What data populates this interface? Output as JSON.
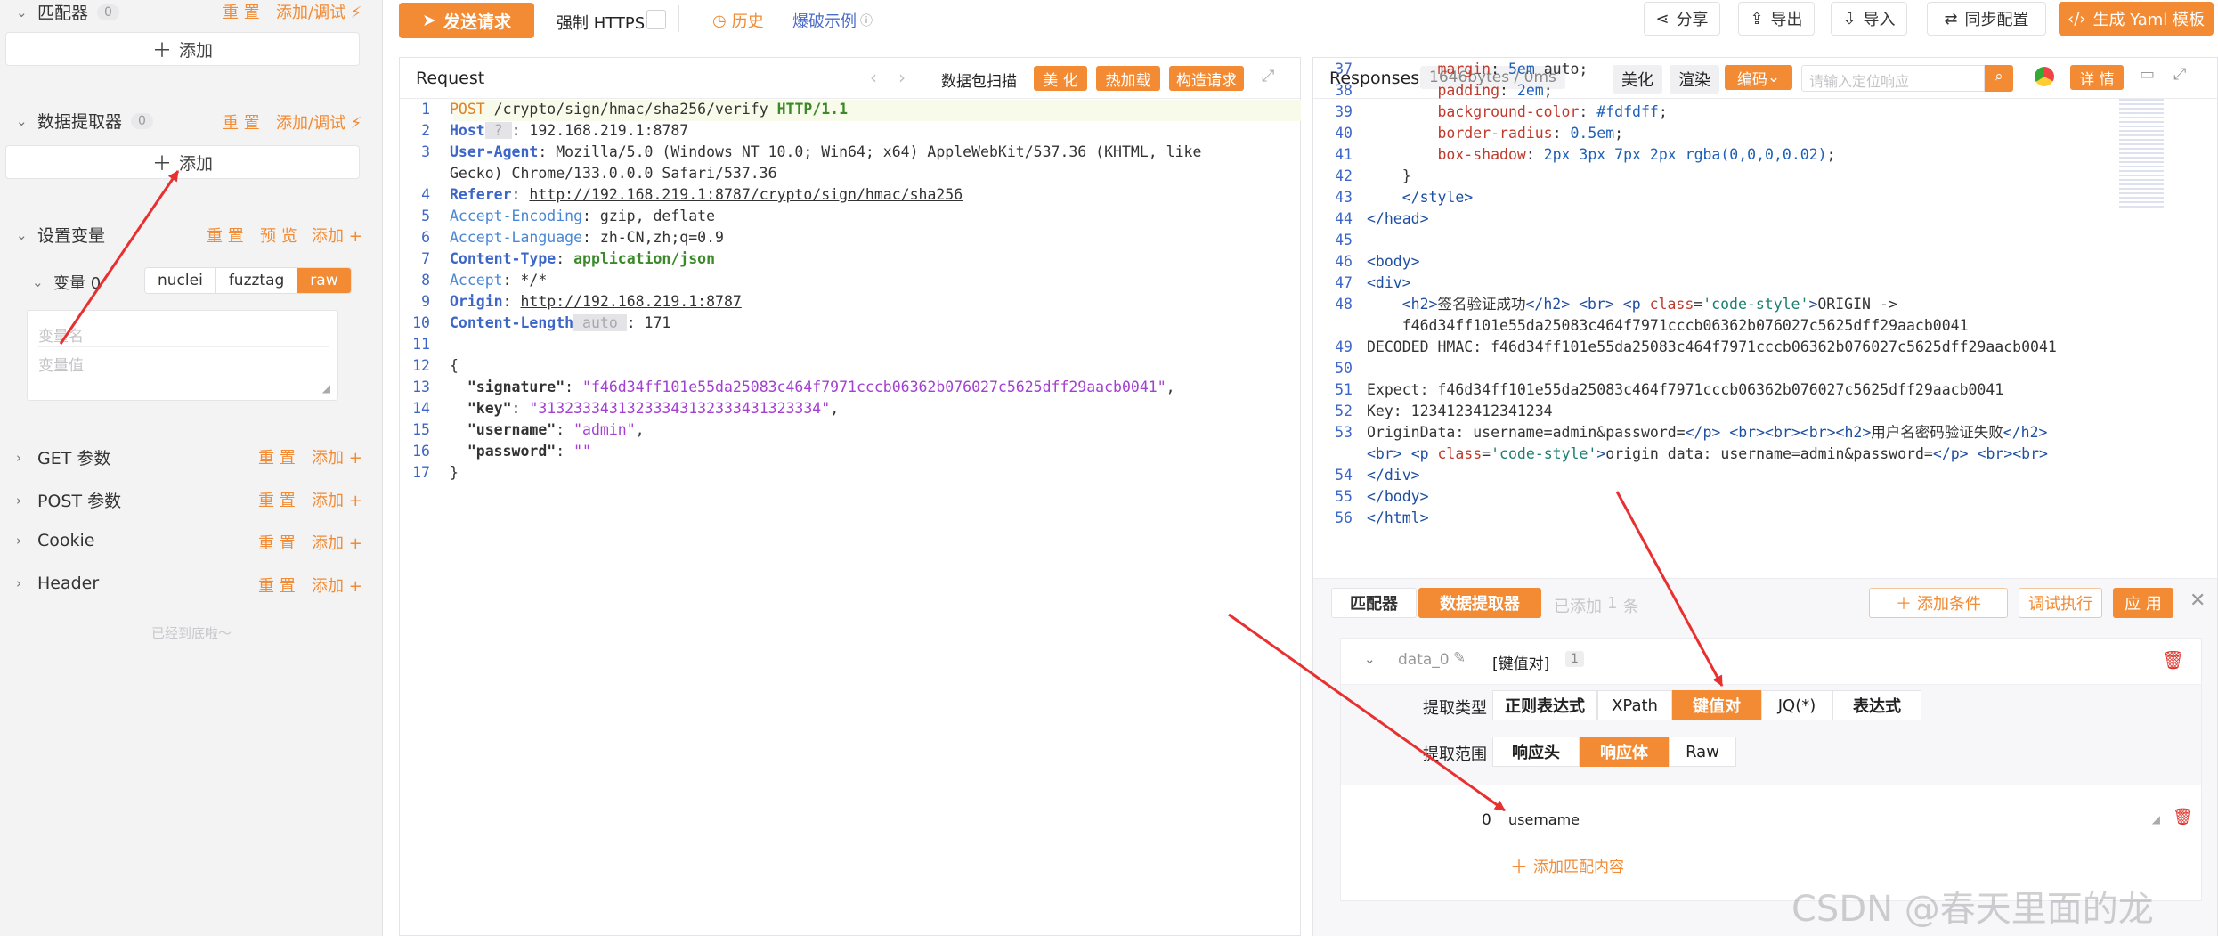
{
  "left": {
    "matcher": {
      "title": "匹配器",
      "count": "0",
      "reset": "重 置",
      "add_debug": "添加/调试 ⚡",
      "add": "添加"
    },
    "extractor": {
      "title": "数据提取器",
      "count": "0",
      "reset": "重 置",
      "add_debug": "添加/调试 ⚡",
      "add": "添加"
    },
    "set_vars": {
      "title": "设置变量",
      "reset": "重 置",
      "preview": "预 览",
      "add": "添加 +"
    },
    "variable": {
      "label": "变量 0",
      "modes": [
        "nuclei",
        "fuzztag",
        "raw"
      ],
      "active_mode": "raw",
      "name_placeholder": "变量名",
      "value_placeholder": "变量值"
    },
    "sections": [
      {
        "title": "GET 参数",
        "reset": "重 置",
        "add": "添加 +"
      },
      {
        "title": "POST 参数",
        "reset": "重 置",
        "add": "添加 +"
      },
      {
        "title": "Cookie",
        "reset": "重 置",
        "add": "添加 +"
      },
      {
        "title": "Header",
        "reset": "重 置",
        "add": "添加 +"
      }
    ],
    "end_text": "已经到底啦～"
  },
  "toolbar": {
    "send": "发送请求",
    "force_https": "强制 HTTPS",
    "history": "历史",
    "example": "爆破示例",
    "share": "分享",
    "export": "导出",
    "import": "导入",
    "sync": "同步配置",
    "gen_yaml": "生成 Yaml 模板"
  },
  "request": {
    "title": "Request",
    "scan": "数据包扫描",
    "beautify": "美 化",
    "hot_load": "热加载",
    "construct": "构造请求",
    "lines": [
      {
        "n": "1",
        "parts": [
          [
            "mth",
            "POST"
          ],
          [
            "val",
            " /crypto/sign/hmac/sha256/verify "
          ],
          [
            "grn",
            "HTTP/1.1"
          ]
        ]
      },
      {
        "n": "2",
        "parts": [
          [
            "k1",
            "Host"
          ],
          [
            "muted",
            " ? "
          ],
          [
            "val",
            ": 192.168.219.1:8787"
          ]
        ]
      },
      {
        "n": "3",
        "parts": [
          [
            "k1",
            "User-Agent"
          ],
          [
            "val",
            ": Mozilla/5.0 (Windows NT 10.0; Win64; x64) AppleWebKit/537.36 (KHTML, like"
          ]
        ]
      },
      {
        "n": "",
        "parts": [
          [
            "val",
            "Gecko) Chrome/133.0.0.0 Safari/537.36"
          ]
        ]
      },
      {
        "n": "4",
        "parts": [
          [
            "k1",
            "Referer"
          ],
          [
            "val",
            ": "
          ],
          [
            "valu",
            "http://192.168.219.1:8787/crypto/sign/hmac/sha256"
          ]
        ]
      },
      {
        "n": "5",
        "parts": [
          [
            "k2",
            "Accept-Encoding"
          ],
          [
            "val",
            ": gzip, deflate"
          ]
        ]
      },
      {
        "n": "6",
        "parts": [
          [
            "k2",
            "Accept-Language"
          ],
          [
            "val",
            ": zh-CN,zh;q=0.9"
          ]
        ]
      },
      {
        "n": "7",
        "parts": [
          [
            "k1",
            "Content-Type"
          ],
          [
            "val",
            ": "
          ],
          [
            "grn",
            "application/json"
          ]
        ]
      },
      {
        "n": "8",
        "parts": [
          [
            "k2",
            "Accept"
          ],
          [
            "val",
            ": */*"
          ]
        ]
      },
      {
        "n": "9",
        "parts": [
          [
            "k1",
            "Origin"
          ],
          [
            "val",
            ": "
          ],
          [
            "valu",
            "http://192.168.219.1:8787"
          ]
        ]
      },
      {
        "n": "10",
        "parts": [
          [
            "k1",
            "Content-Length"
          ],
          [
            "muted",
            " auto "
          ],
          [
            "val",
            ": 171"
          ]
        ]
      },
      {
        "n": "11",
        "parts": []
      },
      {
        "n": "12",
        "parts": [
          [
            "val",
            "{"
          ]
        ]
      },
      {
        "n": "13",
        "parts": [
          [
            "jk",
            "  \"signature\""
          ],
          [
            "val",
            ": "
          ],
          [
            "jv",
            "\"f46d34ff101e55da25083c464f7971cccb06362b076027c5625dff29aacb0041\""
          ],
          [
            "val",
            ","
          ]
        ]
      },
      {
        "n": "14",
        "parts": [
          [
            "jk",
            "  \"key\""
          ],
          [
            "val",
            ": "
          ],
          [
            "jv",
            "\"31323334313233343132333431323334\""
          ],
          [
            "val",
            ","
          ]
        ]
      },
      {
        "n": "15",
        "parts": [
          [
            "jk",
            "  \"username\""
          ],
          [
            "val",
            ": "
          ],
          [
            "jv",
            "\"admin\""
          ],
          [
            "val",
            ","
          ]
        ]
      },
      {
        "n": "16",
        "parts": [
          [
            "jk",
            "  \"password\""
          ],
          [
            "val",
            ": "
          ],
          [
            "jv",
            "\"\""
          ]
        ]
      },
      {
        "n": "17",
        "parts": [
          [
            "val",
            "}"
          ]
        ]
      }
    ]
  },
  "responses": {
    "title": "Responses",
    "size": "1646bytes / 0ms",
    "beautify": "美化",
    "render": "渲染",
    "encoding": "编码",
    "search_placeholder": "请输入定位响应",
    "detail": "详 情",
    "lines": [
      {
        "n": "37",
        "parts": [
          [
            "rattr",
            "        margin"
          ],
          [
            "val",
            ": "
          ],
          [
            "rn",
            "5em"
          ],
          [
            "val",
            " auto;"
          ]
        ]
      },
      {
        "n": "38",
        "parts": [
          [
            "rattr",
            "        padding"
          ],
          [
            "val",
            ": "
          ],
          [
            "rn",
            "2em"
          ],
          [
            "val",
            ";"
          ]
        ]
      },
      {
        "n": "39",
        "parts": [
          [
            "rattr",
            "        background-color"
          ],
          [
            "val",
            ": "
          ],
          [
            "rn",
            "#fdfdff"
          ],
          [
            "val",
            ";"
          ]
        ]
      },
      {
        "n": "40",
        "parts": [
          [
            "rattr",
            "        border-radius"
          ],
          [
            "val",
            ": "
          ],
          [
            "rn",
            "0.5em"
          ],
          [
            "val",
            ";"
          ]
        ]
      },
      {
        "n": "41",
        "parts": [
          [
            "rattr",
            "        box-shadow"
          ],
          [
            "val",
            ": "
          ],
          [
            "rn",
            "2px 3px 7px 2px rgba(0,0,0,0.02)"
          ],
          [
            "val",
            ";"
          ]
        ]
      },
      {
        "n": "42",
        "parts": [
          [
            "val",
            "    }"
          ]
        ]
      },
      {
        "n": "43",
        "parts": [
          [
            "val",
            "    "
          ],
          [
            "rtag",
            "</style>"
          ]
        ]
      },
      {
        "n": "44",
        "parts": [
          [
            "rtag",
            "</head>"
          ]
        ]
      },
      {
        "n": "45",
        "parts": []
      },
      {
        "n": "46",
        "parts": [
          [
            "rtag",
            "<body>"
          ]
        ]
      },
      {
        "n": "47",
        "parts": [
          [
            "rtag",
            "<div>"
          ]
        ]
      },
      {
        "n": "48",
        "parts": [
          [
            "val",
            "    "
          ],
          [
            "rtag",
            "<h2>"
          ],
          [
            "val",
            "签名验证成功"
          ],
          [
            "rtag",
            "</h2>"
          ],
          [
            "val",
            " "
          ],
          [
            "rtag",
            "<br>"
          ],
          [
            "val",
            " "
          ],
          [
            "rtag",
            "<p "
          ],
          [
            "rattr",
            "class"
          ],
          [
            "val",
            "="
          ],
          [
            "rsv",
            "'code-style'"
          ],
          [
            "rtag",
            ">"
          ],
          [
            "val",
            "ORIGIN -> "
          ]
        ]
      },
      {
        "n": "",
        "parts": [
          [
            "val",
            "    f46d34ff101e55da25083c464f7971cccb06362b076027c5625dff29aacb0041"
          ]
        ]
      },
      {
        "n": "49",
        "parts": [
          [
            "val",
            "DECODED HMAC: f46d34ff101e55da25083c464f7971cccb06362b076027c5625dff29aacb0041"
          ]
        ]
      },
      {
        "n": "50",
        "parts": []
      },
      {
        "n": "51",
        "parts": [
          [
            "val",
            "Expect: f46d34ff101e55da25083c464f7971cccb06362b076027c5625dff29aacb0041"
          ]
        ]
      },
      {
        "n": "52",
        "parts": [
          [
            "val",
            "Key: 1234123412341234"
          ]
        ]
      },
      {
        "n": "53",
        "parts": [
          [
            "val",
            "OriginData: username=admin&password="
          ],
          [
            "rtag",
            "</p>"
          ],
          [
            "val",
            " "
          ],
          [
            "rtag",
            "<br><br><br><h2>"
          ],
          [
            "val",
            "用户名密码验证失败"
          ],
          [
            "rtag",
            "</h2>"
          ]
        ]
      },
      {
        "n": "",
        "parts": [
          [
            "rtag",
            "<br>"
          ],
          [
            "val",
            " "
          ],
          [
            "rtag",
            "<p "
          ],
          [
            "rattr",
            "class"
          ],
          [
            "val",
            "="
          ],
          [
            "rsv",
            "'code-style'"
          ],
          [
            "rtag",
            ">"
          ],
          [
            "val",
            "origin data: username=admin&password="
          ],
          [
            "rtag",
            "</p>"
          ],
          [
            "val",
            " "
          ],
          [
            "rtag",
            "<br><br>"
          ]
        ]
      },
      {
        "n": "54",
        "parts": [
          [
            "rtag",
            "</div>"
          ]
        ]
      },
      {
        "n": "55",
        "parts": [
          [
            "rtag",
            "</body>"
          ]
        ]
      },
      {
        "n": "56",
        "parts": [
          [
            "rtag",
            "</html>"
          ]
        ]
      }
    ]
  },
  "extractor_panel": {
    "tab_matcher": "匹配器",
    "tab_extractor": "数据提取器",
    "added_text": "已添加",
    "added_count": "1",
    "added_unit": "条",
    "add_condition": "添加条件",
    "debug_run": "调试执行",
    "apply": "应 用",
    "item_name": "data_0",
    "item_type": "[键值对]",
    "item_index": "1",
    "type_label": "提取类型",
    "types": [
      "正则表达式",
      "XPath",
      "键值对",
      "JQ(*)",
      "表达式"
    ],
    "active_type": "键值对",
    "scope_label": "提取范围",
    "scopes": [
      "响应头",
      "响应体",
      "Raw"
    ],
    "active_scope": "响应体",
    "row_index": "0",
    "row_value": "username",
    "add_match": "添加匹配内容"
  },
  "watermark": "CSDN @春天里面的龙",
  "colors": {
    "accent": "#f28b34",
    "arrow": "#e83030"
  }
}
